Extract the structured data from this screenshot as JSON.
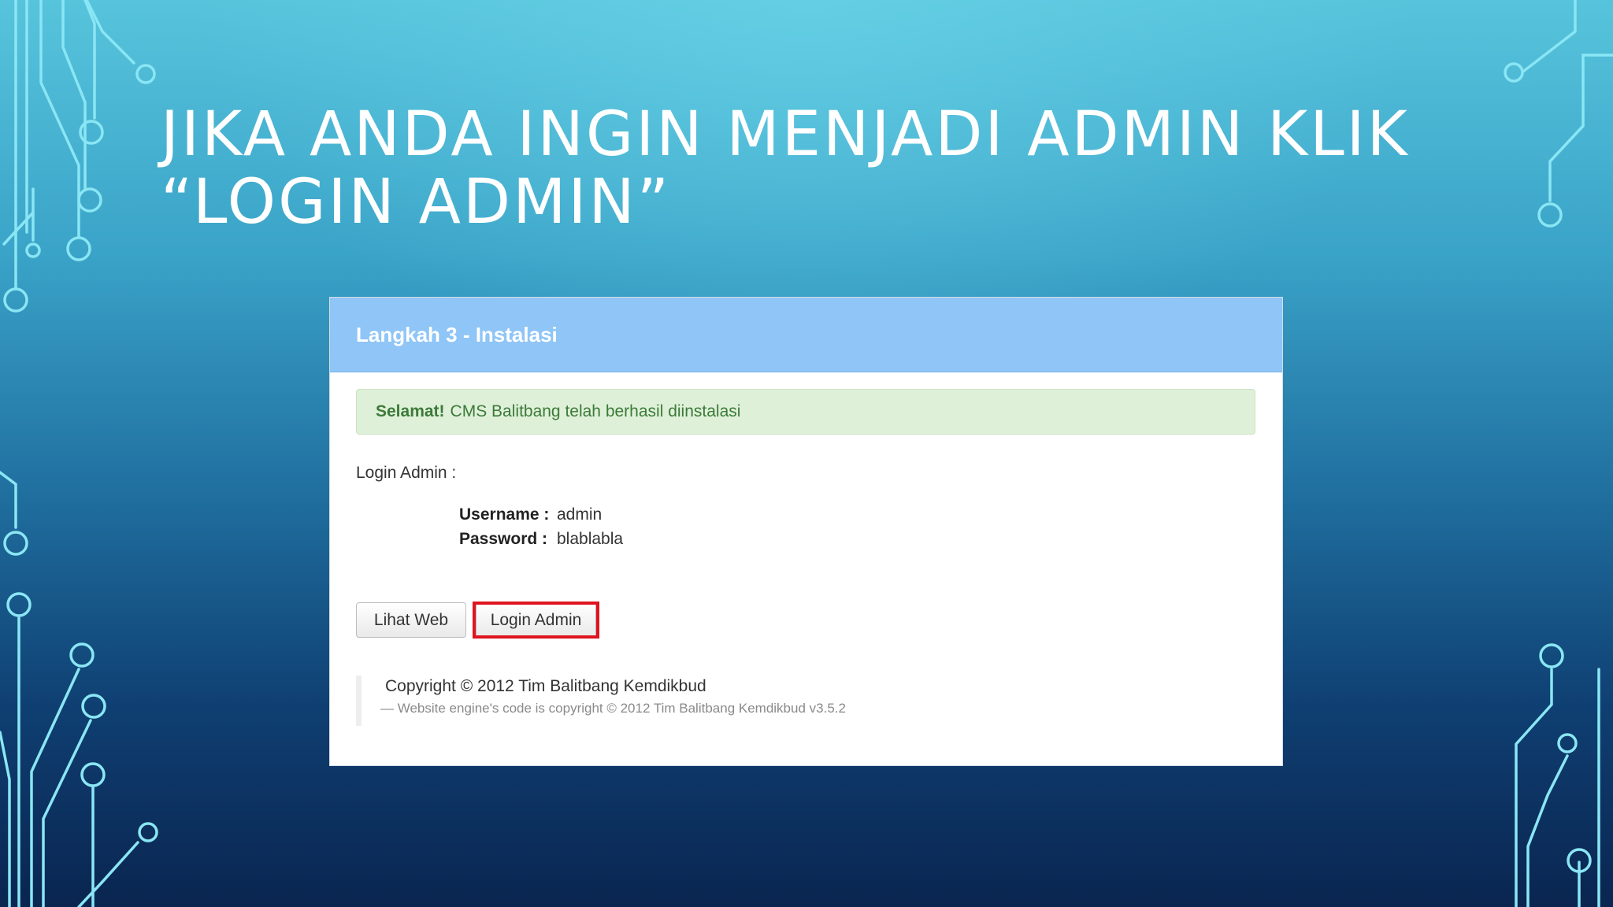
{
  "slide": {
    "title_line1": "Jika anda ingin menjadi admin klik",
    "title_line2": "“Login Admin”"
  },
  "panel": {
    "title": "Langkah 3 - Instalasi",
    "alert_strong": "Selamat!",
    "alert_text": "CMS Balitbang telah berhasil diinstalasi",
    "login_label": "Login Admin :",
    "credentials": [
      {
        "key": "Username :",
        "value": "admin"
      },
      {
        "key": "Password :",
        "value": "blablabla"
      }
    ],
    "buttons": {
      "view_web": "Lihat Web",
      "login_admin": "Login Admin"
    },
    "footer": {
      "copyright": "Copyright © 2012 Tim Balitbang Kemdikbud",
      "engine": "— Website engine's code is copyright © 2012 Tim Balitbang Kemdikbud v3.5.2"
    }
  },
  "colors": {
    "panel_heading": "#8fc5f7",
    "alert_background": "#dff0d8",
    "alert_text": "#3c7a3a",
    "highlight": "#e0141e"
  }
}
